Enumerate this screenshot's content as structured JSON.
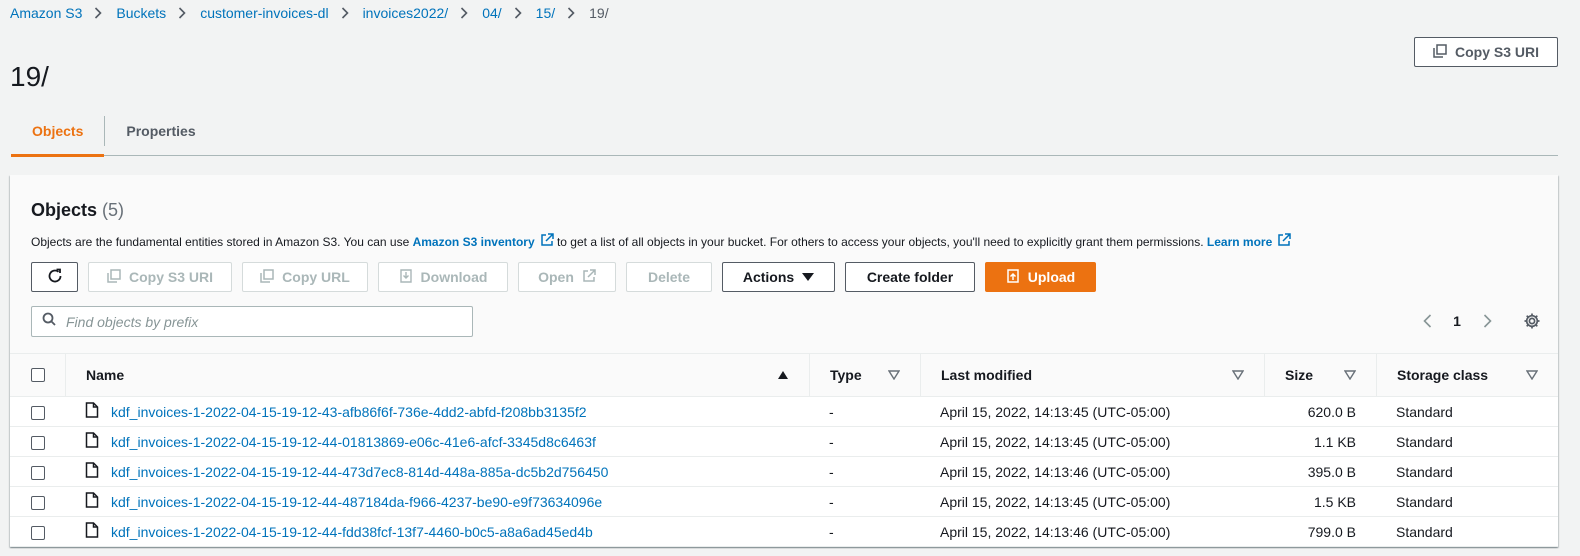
{
  "breadcrumb": [
    "Amazon S3",
    "Buckets",
    "customer-invoices-dl",
    "invoices2022/",
    "04/",
    "15/",
    "19/"
  ],
  "page_title": "19/",
  "header_actions": {
    "copy_s3_uri": "Copy S3 URI"
  },
  "tabs": [
    {
      "label": "Objects",
      "active": true
    },
    {
      "label": "Properties",
      "active": false
    }
  ],
  "objects_panel": {
    "title": "Objects",
    "count": "(5)",
    "description": {
      "part1": "Objects are the fundamental entities stored in Amazon S3. You can use",
      "link1": "Amazon S3 inventory",
      "part2": "to get a list of all objects in your bucket. For others to access your objects, you'll need to explicitly grant them permissions.",
      "link2": "Learn more"
    },
    "toolbar": {
      "copy_s3_uri": "Copy S3 URI",
      "copy_url": "Copy URL",
      "download": "Download",
      "open": "Open",
      "delete": "Delete",
      "actions": "Actions",
      "create_folder": "Create folder",
      "upload": "Upload"
    },
    "search": {
      "placeholder": "Find objects by prefix"
    },
    "pagination": {
      "current_page": "1"
    },
    "columns": [
      "Name",
      "Type",
      "Last modified",
      "Size",
      "Storage class"
    ],
    "rows": [
      {
        "name": "kdf_invoices-1-2022-04-15-19-12-43-afb86f6f-736e-4dd2-abfd-f208bb3135f2",
        "type": "-",
        "last_modified": "April 15, 2022, 14:13:45 (UTC-05:00)",
        "size": "620.0 B",
        "storage_class": "Standard"
      },
      {
        "name": "kdf_invoices-1-2022-04-15-19-12-44-01813869-e06c-41e6-afcf-3345d8c6463f",
        "type": "-",
        "last_modified": "April 15, 2022, 14:13:45 (UTC-05:00)",
        "size": "1.1 KB",
        "storage_class": "Standard"
      },
      {
        "name": "kdf_invoices-1-2022-04-15-19-12-44-473d7ec8-814d-448a-885a-dc5b2d756450",
        "type": "-",
        "last_modified": "April 15, 2022, 14:13:46 (UTC-05:00)",
        "size": "395.0 B",
        "storage_class": "Standard"
      },
      {
        "name": "kdf_invoices-1-2022-04-15-19-12-44-487184da-f966-4237-be90-e9f73634096e",
        "type": "-",
        "last_modified": "April 15, 2022, 14:13:45 (UTC-05:00)",
        "size": "1.5 KB",
        "storage_class": "Standard"
      },
      {
        "name": "kdf_invoices-1-2022-04-15-19-12-44-fdd38fcf-13f7-4460-b0c5-a8a6ad45ed4b",
        "type": "-",
        "last_modified": "April 15, 2022, 14:13:46 (UTC-05:00)",
        "size": "799.0 B",
        "storage_class": "Standard"
      }
    ]
  },
  "colors": {
    "link": "#0073bb",
    "accent": "#ec7211",
    "text": "#16191f",
    "muted": "#545b64",
    "disabled": "#aab7b8"
  },
  "icons": [
    "chevron-right-icon",
    "copy-icon",
    "refresh-icon",
    "download-icon",
    "external-link-icon",
    "caret-down-icon",
    "upload-icon",
    "search-icon",
    "chevron-left-icon",
    "gear-icon",
    "sort-ascending-icon",
    "sort-icon",
    "file-icon"
  ]
}
